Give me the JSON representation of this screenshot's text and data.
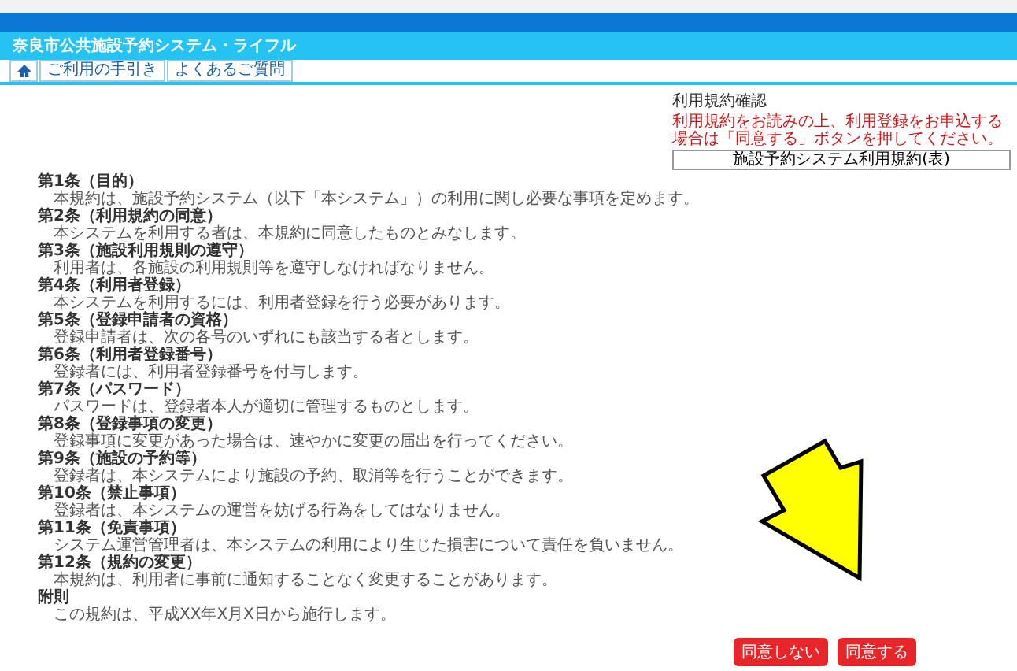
{
  "header": {
    "title": "奈良市公共施設予約システム・ライフル"
  },
  "nav": {
    "tabs": [
      {
        "label": "ご利用の手引き",
        "selected": false
      },
      {
        "label": "よくあるご質問",
        "selected": false
      }
    ]
  },
  "consent_box": {
    "label": "利用規約確認",
    "notice": "利用規約をお読みの上、利用登録をお申込する場合は「同意する」ボタンを押してください。",
    "link": "施設予約システム利用規約(表)"
  },
  "articles": [
    {
      "heading": "第1条（目的）",
      "body": "本規約は、施設予約システム（以下「本システム」）の利用に関し必要な事項を定めます。"
    },
    {
      "heading": "第2条（利用規約の同意）",
      "body": "本システムを利用する者は、本規約に同意したものとみなします。"
    },
    {
      "heading": "第3条（施設利用規則の遵守）",
      "body": "利用者は、各施設の利用規則等を遵守しなければなりません。"
    },
    {
      "heading": "第4条（利用者登録）",
      "body": "本システムを利用するには、利用者登録を行う必要があります。"
    },
    {
      "heading": "第5条（登録申請者の資格）",
      "body": "登録申請者は、次の各号のいずれにも該当する者とします。"
    },
    {
      "heading": "第6条（利用者登録番号）",
      "body": "登録者には、利用者登録番号を付与します。"
    },
    {
      "heading": "第7条（パスワード）",
      "body": "パスワードは、登録者本人が適切に管理するものとします。"
    },
    {
      "heading": "第8条（登録事項の変更）",
      "body": "登録事項に変更があった場合は、速やかに変更の届出を行ってください。"
    },
    {
      "heading": "第9条（施設の予約等）",
      "body": "登録者は、本システムにより施設の予約、取消等を行うことができます。"
    },
    {
      "heading": "第10条（禁止事項）",
      "body": "登録者は、本システムの運営を妨げる行為をしてはなりません。"
    },
    {
      "heading": "第11条（免責事項）",
      "body": "システム運営管理者は、本システムの利用により生じた損害について責任を負いません。"
    },
    {
      "heading": "第12条（規約の変更）",
      "body": "本規約は、利用者に事前に通知することなく変更することがあります。"
    },
    {
      "heading": "附則",
      "body": "この規約は、平成XX年X月X日から施行します。"
    }
  ],
  "actions": [
    {
      "label": "同意しない"
    },
    {
      "label": "同意する"
    }
  ]
}
